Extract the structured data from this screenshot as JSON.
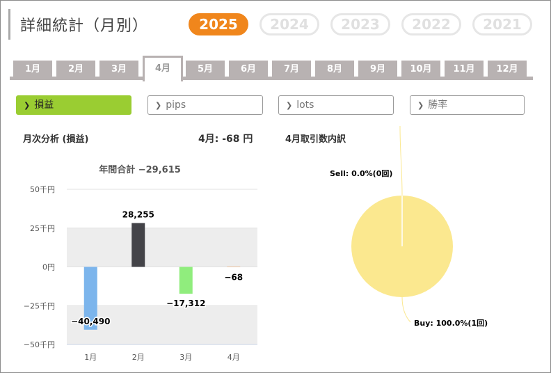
{
  "page": {
    "title": "詳細統計（月別）"
  },
  "years": [
    {
      "label": "2025",
      "active": true
    },
    {
      "label": "2024",
      "active": false
    },
    {
      "label": "2023",
      "active": false
    },
    {
      "label": "2022",
      "active": false
    },
    {
      "label": "2021",
      "active": false
    }
  ],
  "months": [
    {
      "label": "1月",
      "active": false
    },
    {
      "label": "2月",
      "active": false
    },
    {
      "label": "3月",
      "active": false
    },
    {
      "label": "4月",
      "active": true
    },
    {
      "label": "5月",
      "active": false
    },
    {
      "label": "6月",
      "active": false
    },
    {
      "label": "7月",
      "active": false
    },
    {
      "label": "8月",
      "active": false
    },
    {
      "label": "9月",
      "active": false
    },
    {
      "label": "10月",
      "active": false
    },
    {
      "label": "11月",
      "active": false
    },
    {
      "label": "12月",
      "active": false
    }
  ],
  "metrics": [
    {
      "label": "損益",
      "active": true
    },
    {
      "label": "pips",
      "active": false
    },
    {
      "label": "lots",
      "active": false
    },
    {
      "label": "勝率",
      "active": false
    }
  ],
  "left_panel": {
    "title": "月次分析 (損益)",
    "summary": "4月:  -68 円"
  },
  "right_panel": {
    "title": "4月取引数内訳"
  },
  "colors": {
    "accent_orange": "#f0861c",
    "accent_green": "#9acd32"
  },
  "chart_data": [
    {
      "type": "bar",
      "title": "年間合計 −29,615",
      "categories": [
        "1月",
        "2月",
        "3月",
        "4月"
      ],
      "values": [
        -40490,
        28255,
        -17312,
        -68
      ],
      "value_labels": [
        "−40,490",
        "28,255",
        "−17,312",
        "−68"
      ],
      "bar_colors": [
        "#7cb5ec",
        "#434348",
        "#90ed7d",
        "#f7a35c"
      ],
      "yticks": [
        50000,
        25000,
        0,
        -25000,
        -50000
      ],
      "ytick_labels": [
        "50千円",
        "25千円",
        "0円",
        "−25千円",
        "−50千円"
      ],
      "ylim": [
        -50000,
        50000
      ],
      "grid": true,
      "alternating_bands": true
    },
    {
      "type": "pie",
      "slices": [
        {
          "name": "Sell",
          "percent": 0.0,
          "count": 0,
          "label": "Sell: 0.0%(0回)",
          "color": "#f7a35c"
        },
        {
          "name": "Buy",
          "percent": 100.0,
          "count": 1,
          "label": "Buy: 100.0%(1回)",
          "color": "#fbe88f"
        }
      ]
    }
  ]
}
